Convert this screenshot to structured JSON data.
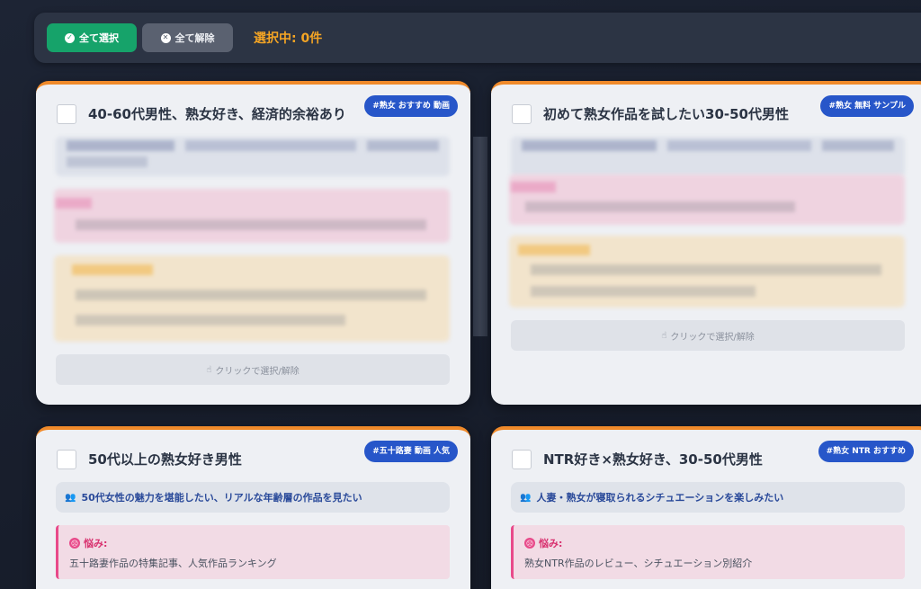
{
  "toolbar": {
    "select_all_label": "全て選択",
    "clear_all_label": "全て解除",
    "selected_count_text": "選択中: 0件"
  },
  "colors": {
    "background": "#1b2130",
    "select_all": "#16a36a",
    "clear_all": "#5a6170",
    "accent_orange": "#f5a524",
    "tag_blue": "#2756c9",
    "pain_pink": "#e84a8a"
  },
  "cards": [
    {
      "title": "40-60代男性、熟女好き、経済的余裕あり",
      "tag": "#熟女 おすすめ 動画",
      "click_hint": "クリックで選択/解除"
    },
    {
      "title": "初めて熟女作品を試したい30-50代男性",
      "tag": "#熟女 無料 サンプル",
      "click_hint": "クリックで選択/解除"
    },
    {
      "title": "50代以上の熟女好き男性",
      "tag": "#五十路妻 動画 人気",
      "target": "50代女性の魅力を堪能したい、リアルな年齢層の作品を見たい",
      "pain_label": "悩み:",
      "pain_text": "五十路妻作品の特集記事、人気作品ランキング"
    },
    {
      "title": "NTR好き×熟女好き、30-50代男性",
      "tag": "#熟女 NTR おすすめ",
      "target": "人妻・熟女が寝取られるシチュエーションを楽しみたい",
      "pain_label": "悩み:",
      "pain_text": "熟女NTR作品のレビュー、シチュエーション別紹介"
    }
  ],
  "icons": {
    "select_all": "check-circle-icon",
    "clear_all": "x-circle-icon",
    "click_hint": "pointer-hand-icon",
    "target": "users-icon",
    "pain": "frown-icon"
  }
}
